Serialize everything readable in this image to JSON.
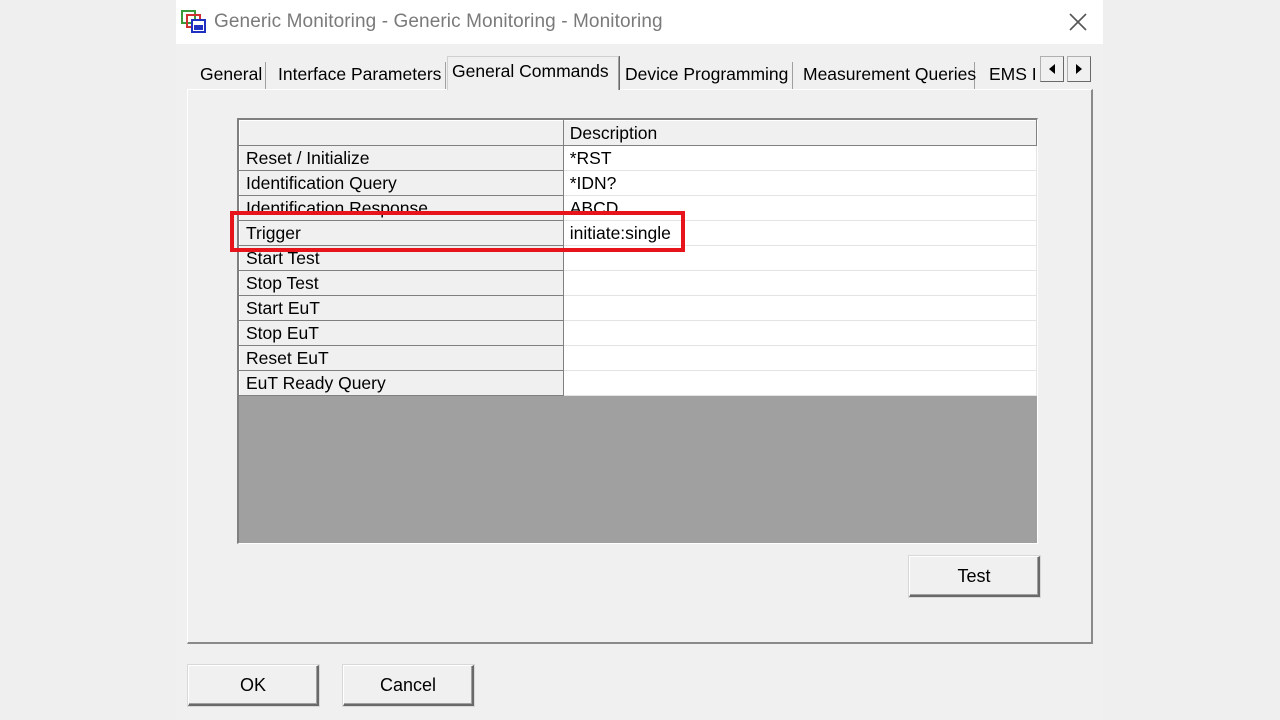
{
  "window": {
    "title": "Generic Monitoring - Generic Monitoring - Monitoring"
  },
  "tabs": [
    {
      "label": "General",
      "active": false
    },
    {
      "label": "Interface Parameters",
      "active": false
    },
    {
      "label": "General Commands",
      "active": true
    },
    {
      "label": "Device Programming",
      "active": false
    },
    {
      "label": "Measurement Queries",
      "active": false
    },
    {
      "label": "EMS I",
      "active": false
    }
  ],
  "grid": {
    "header": {
      "name": "",
      "description": "Description"
    },
    "rows": [
      {
        "name": "Reset / Initialize",
        "description": "*RST"
      },
      {
        "name": "Identification Query",
        "description": "*IDN?"
      },
      {
        "name": "Identification Response",
        "description": "ABCD"
      },
      {
        "name": "Trigger",
        "description": "initiate:single"
      },
      {
        "name": "Start Test",
        "description": ""
      },
      {
        "name": "Stop Test",
        "description": ""
      },
      {
        "name": "Start EuT",
        "description": ""
      },
      {
        "name": "Stop EuT",
        "description": ""
      },
      {
        "name": "Reset EuT",
        "description": ""
      },
      {
        "name": "EuT Ready Query",
        "description": ""
      }
    ]
  },
  "buttons": {
    "test": "Test",
    "ok": "OK",
    "cancel": "Cancel"
  },
  "icons": {
    "app": "window-monitor-icon",
    "close": "close-icon",
    "tab_left": "arrow-left-icon",
    "tab_right": "arrow-right-icon"
  },
  "colors": {
    "highlight": "#e8141c"
  }
}
